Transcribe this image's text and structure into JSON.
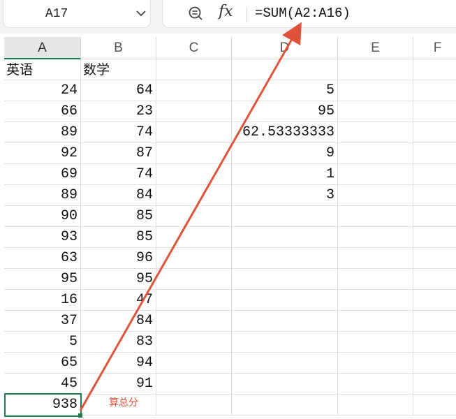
{
  "name_box": {
    "value": "A17"
  },
  "formula_bar": {
    "formula": "=SUM(A2:A16)"
  },
  "columns": [
    "A",
    "B",
    "C",
    "D",
    "E",
    "F"
  ],
  "active_column": "A",
  "cells": {
    "A1": "英语",
    "B1": "数学",
    "A2": "24",
    "B2": "64",
    "D2": "5",
    "A3": "66",
    "B3": "23",
    "D3": "95",
    "A4": "89",
    "B4": "74",
    "D4": "62.53333333",
    "A5": "92",
    "B5": "87",
    "D5": "9",
    "A6": "69",
    "B6": "74",
    "D6": "1",
    "A7": "89",
    "B7": "84",
    "D7": "3",
    "A8": "90",
    "B8": "85",
    "A9": "93",
    "B9": "85",
    "A10": "63",
    "B10": "96",
    "A11": "95",
    "B11": "95",
    "A12": "16",
    "B12": "47",
    "A13": "37",
    "B13": "84",
    "A14": "5",
    "B14": "83",
    "A15": "65",
    "B15": "94",
    "A16": "45",
    "B16": "91",
    "A17": "938"
  },
  "selected_cell": "A17",
  "annotation": {
    "text": "算总分",
    "color": "#e0533a"
  },
  "colors": {
    "accent": "#1e7b4d",
    "annotation": "#e0533a"
  },
  "icons": [
    "chevron-down-icon",
    "zoom-icon",
    "fx-icon"
  ]
}
